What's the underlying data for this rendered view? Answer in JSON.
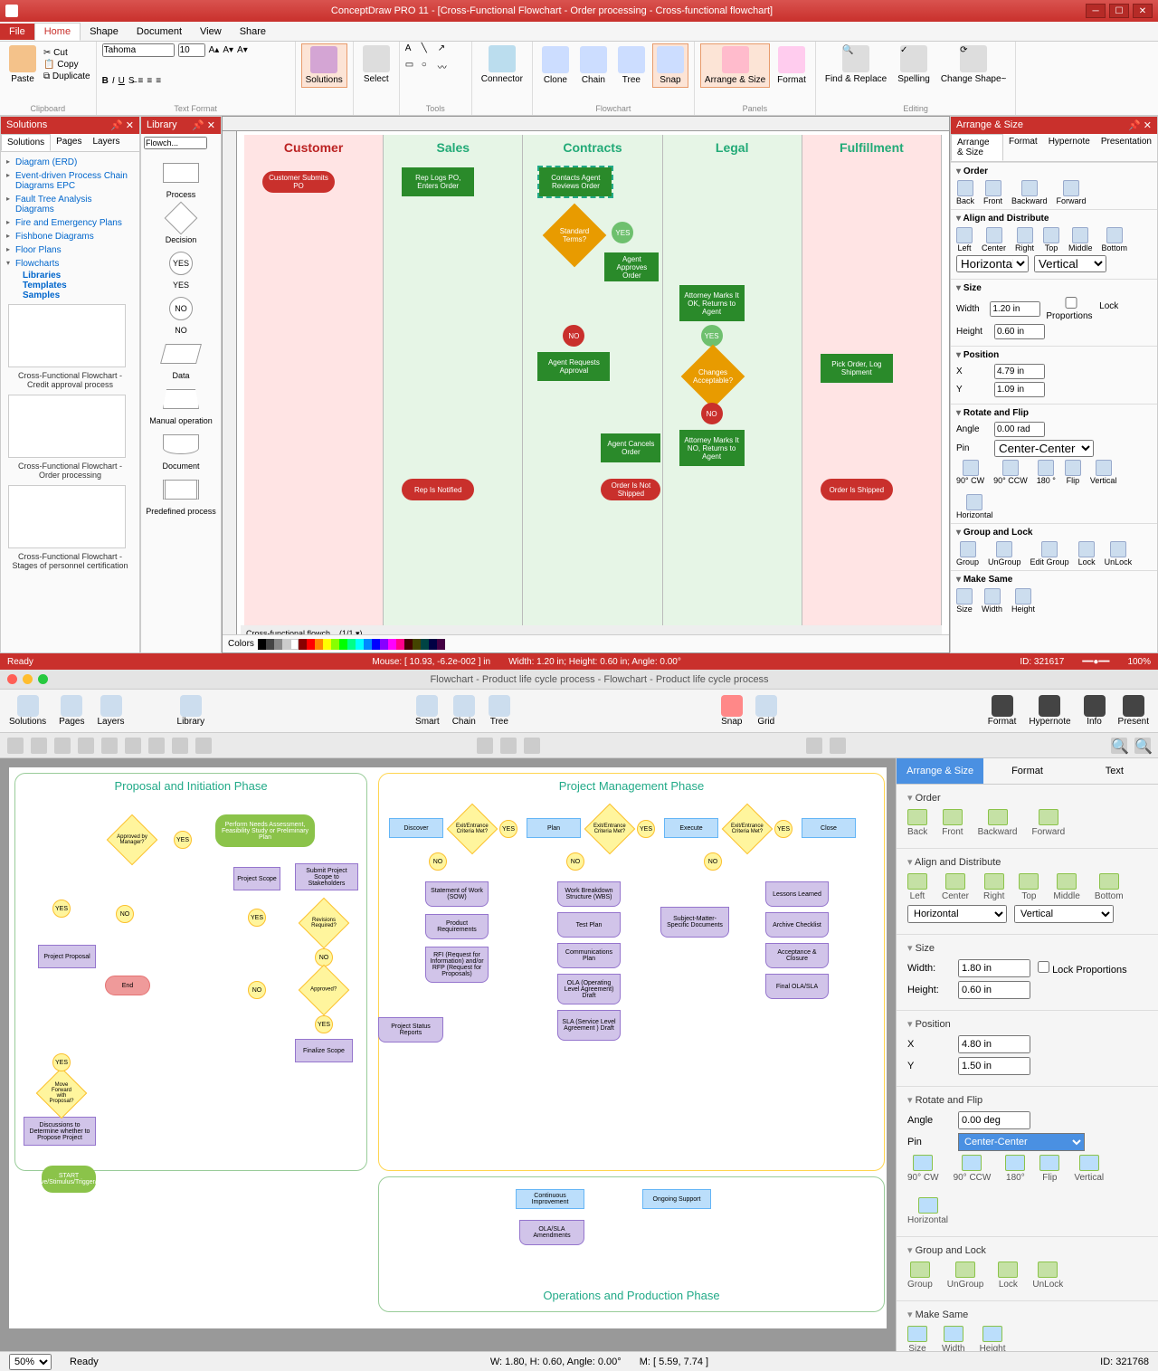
{
  "app1": {
    "title": "ConceptDraw PRO 11 - [Cross-Functional Flowchart - Order processing - Cross-functional flowchart]",
    "menuTabs": [
      "File",
      "Home",
      "Shape",
      "Document",
      "View",
      "Share"
    ],
    "ribbon": {
      "clipboard": {
        "paste": "Paste",
        "cut": "Cut",
        "copy": "Copy",
        "dup": "Duplicate",
        "label": "Clipboard"
      },
      "font": {
        "name": "Tahoma",
        "size": "10",
        "label": "Text Format"
      },
      "solutions": {
        "label": "Solutions"
      },
      "select": {
        "label": "Select"
      },
      "tools": {
        "label": "Tools"
      },
      "connector": {
        "label": "Connector"
      },
      "clone": "Clone",
      "chain": "Chain",
      "tree": "Tree",
      "snap": "Snap",
      "arrange": "Arrange & Size",
      "format": "Format",
      "flowchart": "Flowchart",
      "panels": "Panels",
      "find": "Find & Replace",
      "spell": "Spelling",
      "change": "Change Shape~",
      "editing": "Editing"
    },
    "solPanel": {
      "title": "Solutions",
      "tabs": [
        "Solutions",
        "Pages",
        "Layers"
      ],
      "items": [
        "Diagram (ERD)",
        "Event-driven Process Chain Diagrams EPC",
        "Fault Tree Analysis Diagrams",
        "Fire and Emergency Plans",
        "Fishbone Diagrams",
        "Floor Plans",
        "Flowcharts"
      ],
      "subs": [
        "Libraries",
        "Templates",
        "Samples"
      ],
      "thumbs": [
        "Cross-Functional Flowchart - Credit approval process",
        "Cross-Functional Flowchart - Order processing",
        "Cross-Functional Flowchart - Stages of personnel certification"
      ]
    },
    "libPanel": {
      "title": "Library",
      "dropdown": "Flowch...",
      "shapes": [
        "Process",
        "Decision",
        "YES",
        "NO",
        "Data",
        "Manual operation",
        "Document",
        "Predefined process"
      ]
    },
    "chart": {
      "lanes": [
        "Customer",
        "Sales",
        "Contracts",
        "Legal",
        "Fulfillment"
      ],
      "nodes": {
        "custSubmit": "Customer Submits PO",
        "repLogs": "Rep Logs PO, Enters Order",
        "contactsAgent": "Contacts Agent Reviews Order",
        "stdTerms": "Standard Terms?",
        "agentApproves": "Agent Approves Order",
        "attorneyOK": "Attorney Marks It OK, Returns to Agent",
        "agentRequests": "Agent Requests Approval",
        "changesAcc": "Changes Acceptable?",
        "pickOrder": "Pick Order, Log Shipment",
        "attorneyNO": "Attorney Marks It NO, Returns to Agent",
        "agentCancels": "Agent Cancels Order",
        "repNotified": "Rep Is Notified",
        "notShipped": "Order Is Not Shipped",
        "shipped": "Order Is Shipped",
        "yes": "YES",
        "no": "NO"
      },
      "pageTab": "Cross-functional flowch...  (1/1 ▾)"
    },
    "colors": "Colors",
    "arrangePanel": {
      "title": "Arrange & Size",
      "tabs": [
        "Arrange & Size",
        "Format",
        "Hypernote",
        "Presentation"
      ],
      "order": {
        "title": "Order",
        "btns": [
          "Back",
          "Front",
          "Backward",
          "Forward"
        ]
      },
      "align": {
        "title": "Align and Distribute",
        "btns": [
          "Left",
          "Center",
          "Right",
          "Top",
          "Middle",
          "Bottom"
        ],
        "horiz": "Horizontal",
        "vert": "Vertical"
      },
      "size": {
        "title": "Size",
        "width": "Width",
        "widthV": "1.20 in",
        "height": "Height",
        "heightV": "0.60 in",
        "lock": "Lock Proportions"
      },
      "pos": {
        "title": "Position",
        "x": "X",
        "xV": "4.79 in",
        "y": "Y",
        "yV": "1.09 in"
      },
      "rotate": {
        "title": "Rotate and Flip",
        "angle": "Angle",
        "angleV": "0.00 rad",
        "pin": "Pin",
        "pinV": "Center-Center",
        "btns": [
          "90° CW",
          "90° CCW",
          "180 °",
          "Flip",
          "Vertical",
          "Horizontal"
        ]
      },
      "group": {
        "title": "Group and Lock",
        "btns": [
          "Group",
          "UnGroup",
          "Edit Group",
          "Lock",
          "UnLock"
        ]
      },
      "same": {
        "title": "Make Same",
        "btns": [
          "Size",
          "Width",
          "Height"
        ]
      }
    },
    "status": {
      "ready": "Ready",
      "mouse": "Mouse: [ 10.93, -6.2e-002 ] in",
      "dims": "Width: 1.20 in;  Height: 0.60 in;  Angle: 0.00°",
      "id": "ID: 321617",
      "zoom": "100%"
    }
  },
  "app2": {
    "title": "Flowchart - Product life cycle process - Flowchart - Product life cycle process",
    "toolbar": [
      "Solutions",
      "Pages",
      "Layers",
      "Library",
      "Smart",
      "Chain",
      "Tree",
      "Snap",
      "Grid",
      "Format",
      "Hypernote",
      "Info",
      "Present"
    ],
    "chart": {
      "phase1": "Proposal and Initiation Phase",
      "phase2": "Project Management Phase",
      "phase3": "Operations and Production Phase",
      "nodes": {
        "start": "START Motive/Stimulus/Trigger/Idea",
        "discuss": "Discussions to Determine whether to Propose Project",
        "moveFwd": "Move Forward with Proposal?",
        "projProp": "Project Proposal",
        "apprMgr": "Approved by Manager?",
        "needs": "Perform Needs Assessment, Feasibility Study or Preliminary Plan",
        "projScope": "Project Scope",
        "submitScope": "Submit Project Scope to Stakeholders",
        "revReq": "Revisions Required?",
        "approved": "Approved?",
        "finalize": "Finalize Scope",
        "end": "End",
        "projStatus": "Project Status Reports",
        "discover": "Discover",
        "exit1": "Exit/Entrance Criteria Met?",
        "plan": "Plan",
        "exit2": "Exit/Entrance Criteria Met?",
        "execute": "Execute",
        "exit3": "Exit/Entrance Criteria Met?",
        "close": "Close",
        "sow": "Statement of Work (SOW)",
        "prodReq": "Product Requirements",
        "rfi": "RFI (Request for Information) and/or RFP (Request for Proposals)",
        "wbs": "Work Breakdown Structure (WBS)",
        "testPlan": "Test Plan",
        "commPlan": "Communications Plan",
        "ola": "OLA (Operating Level Agreement) Draft",
        "sla": "SLA (Service Level Agreement ) Draft",
        "smd": "Subject-Matter-Specific Documents",
        "lessons": "Lessons Learned",
        "archive": "Archive Checklist",
        "accept": "Acceptance & Closure",
        "finalOla": "Final OLA/SLA",
        "contImp": "Continuous Improvement",
        "olaAmend": "OLA/SLA Amendments",
        "ongoing": "Ongoing Support",
        "yes": "YES",
        "no": "NO"
      }
    },
    "panel": {
      "tabs": [
        "Arrange & Size",
        "Format",
        "Text"
      ],
      "order": {
        "title": "Order",
        "btns": [
          "Back",
          "Front",
          "Backward",
          "Forward"
        ]
      },
      "align": {
        "title": "Align and Distribute",
        "btns": [
          "Left",
          "Center",
          "Right",
          "Top",
          "Middle",
          "Bottom"
        ],
        "h": "Horizontal",
        "v": "Vertical"
      },
      "size": {
        "title": "Size",
        "width": "Width:",
        "widthV": "1.80 in",
        "height": "Height:",
        "heightV": "0.60 in",
        "lock": "Lock Proportions"
      },
      "pos": {
        "title": "Position",
        "x": "X",
        "xV": "4.80 in",
        "y": "Y",
        "yV": "1.50 in"
      },
      "rotate": {
        "title": "Rotate and Flip",
        "angle": "Angle",
        "angleV": "0.00 deg",
        "pin": "Pin",
        "pinV": "Center-Center",
        "btns": [
          "90° CW",
          "90° CCW",
          "180°",
          "Flip",
          "Vertical",
          "Horizontal"
        ]
      },
      "group": {
        "title": "Group and Lock",
        "btns": [
          "Group",
          "UnGroup",
          "Lock",
          "UnLock"
        ]
      },
      "same": {
        "title": "Make Same",
        "btns": [
          "Size",
          "Width",
          "Height"
        ]
      }
    },
    "status": {
      "zoom": "50%",
      "ready": "Ready",
      "wh": "W: 1.80,  H: 0.60,  Angle: 0.00°",
      "m": "M: [ 5.59, 7.74 ]",
      "id": "ID: 321768"
    }
  }
}
